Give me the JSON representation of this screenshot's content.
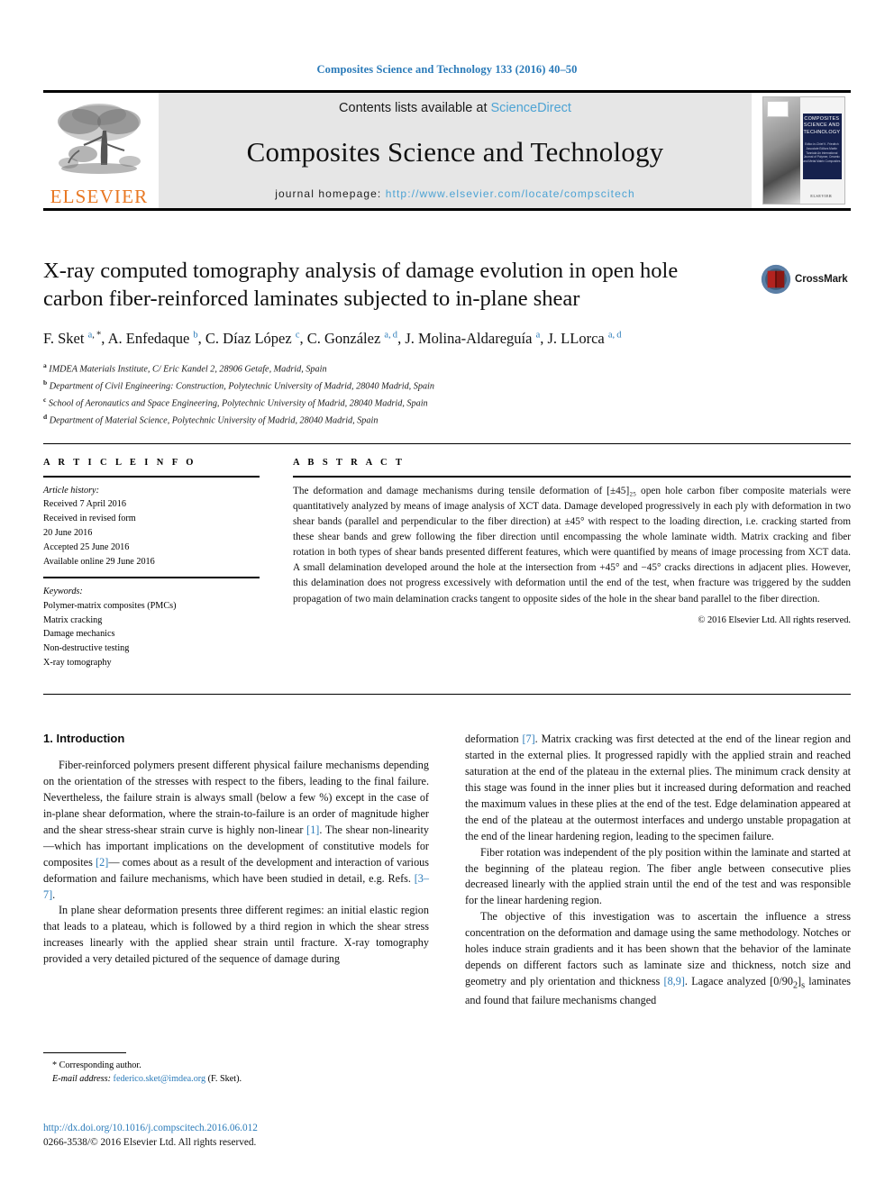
{
  "running_head": "Composites Science and Technology 133 (2016) 40–50",
  "masthead": {
    "contents_prefix": "Contents lists available at ",
    "sciencedirect": "ScienceDirect",
    "journal_name": "Composites Science and Technology",
    "homepage_label": "journal homepage: ",
    "homepage_url": "http://www.elsevier.com/locate/compscitech",
    "publisher": "ELSEVIER",
    "cover": {
      "title": "COMPOSITES SCIENCE AND TECHNOLOGY",
      "subtitle": "Editor-in-Chief\nK. Friedrich\n\nAssociate Editors\nMartin Tanniala\n\nAn International Journal\nof Polymer, Ceramic and Metal\nMatrix Composites",
      "publisher": "ELSEVIER"
    }
  },
  "article": {
    "title": "X-ray computed tomography analysis of damage evolution in open hole carbon fiber-reinforced laminates subjected to in-plane shear",
    "crossmark_label": "CrossMark",
    "authors_html": "F. Sket <sup>a, *</sup>, A. Enfedaque <sup>b</sup>, C. Díaz López <sup>c</sup>, C. González <sup>a, d</sup>, J. Molina-Aldareguía <sup>a</sup>, J. LLorca <sup>a, d</sup>",
    "affiliations": [
      {
        "mark": "a",
        "text": "IMDEA Materials Institute, C/ Eric Kandel 2, 28906 Getafe, Madrid, Spain"
      },
      {
        "mark": "b",
        "text": "Department of Civil Engineering: Construction, Polytechnic University of Madrid, 28040 Madrid, Spain"
      },
      {
        "mark": "c",
        "text": "School of Aeronautics and Space Engineering, Polytechnic University of Madrid, 28040 Madrid, Spain"
      },
      {
        "mark": "d",
        "text": "Department of Material Science, Polytechnic University of Madrid, 28040 Madrid, Spain"
      }
    ]
  },
  "article_info": {
    "heading": "A R T I C L E   I N F O",
    "history_label": "Article history:",
    "history": [
      "Received 7 April 2016",
      "Received in revised form",
      "20 June 2016",
      "Accepted 25 June 2016",
      "Available online 29 June 2016"
    ],
    "keywords_label": "Keywords:",
    "keywords": [
      "Polymer-matrix composites (PMCs)",
      "Matrix cracking",
      "Damage mechanics",
      "Non-destructive testing",
      "X-ray tomography"
    ]
  },
  "abstract": {
    "heading": "A B S T R A C T",
    "text": "The deformation and damage mechanisms during tensile deformation of [±45]₂₅ open hole carbon fiber composite materials were quantitatively analyzed by means of image analysis of XCT data. Damage developed progressively in each ply with deformation in two shear bands (parallel and perpendicular to the fiber direction) at ±45° with respect to the loading direction, i.e. cracking started from these shear bands and grew following the fiber direction until encompassing the whole laminate width. Matrix cracking and fiber rotation in both types of shear bands presented different features, which were quantified by means of image processing from XCT data. A small delamination developed around the hole at the intersection from +45° and −45° cracks directions in adjacent plies. However, this delamination does not progress excessively with deformation until the end of the test, when fracture was triggered by the sudden propagation of two main delamination cracks tangent to opposite sides of the hole in the shear band parallel to the fiber direction.",
    "copyright": "© 2016 Elsevier Ltd. All rights reserved."
  },
  "body": {
    "section_title": "1.  Introduction",
    "left_paragraphs": [
      "Fiber-reinforced polymers present different physical failure mechanisms depending on the orientation of the stresses with respect to the fibers, leading to the final failure. Nevertheless, the failure strain is always small (below a few %) except in the case of in-plane shear deformation, where the strain-to-failure is an order of magnitude higher and the shear stress-shear strain curve is highly non-linear [1]. The shear non-linearity —which has important implications on the development of constitutive models for composites [2]— comes about as a result of the development and interaction of various deformation and failure mechanisms, which have been studied in detail, e.g. Refs. [3–7].",
      "In plane shear deformation presents three different regimes: an initial elastic region that leads to a plateau, which is followed by a third region in which the shear stress increases linearly with the applied shear strain until fracture. X-ray tomography provided a very detailed pictured of the sequence of damage during"
    ],
    "right_paragraphs": [
      "deformation [7]. Matrix cracking was first detected at the end of the linear region and started in the external plies. It progressed rapidly with the applied strain and reached saturation at the end of the plateau in the external plies. The minimum crack density at this stage was found in the inner plies but it increased during deformation and reached the maximum values in these plies at the end of the test. Edge delamination appeared at the end of the plateau at the outermost interfaces and undergo unstable propagation at the end of the linear hardening region, leading to the specimen failure.",
      "Fiber rotation was independent of the ply position within the laminate and started at the beginning of the plateau region. The fiber angle between consecutive plies decreased linearly with the applied strain until the end of the test and was responsible for the linear hardening region.",
      "The objective of this investigation was to ascertain the influence a stress concentration on the deformation and damage using the same methodology. Notches or holes induce strain gradients and it has been shown that the behavior of the laminate depends on different factors such as laminate size and thickness, notch size and geometry and ply orientation and thickness [8,9]. Lagace analyzed [0/90₂]ₛ laminates and found that failure mechanisms changed"
    ]
  },
  "footnote": {
    "corresponding": "* Corresponding author.",
    "email_label": "E-mail address: ",
    "email": "federico.sket@imdea.org",
    "email_suffix": " (F. Sket)."
  },
  "footer": {
    "doi": "http://dx.doi.org/10.1016/j.compscitech.2016.06.012",
    "issn": "0266-3538/© 2016 Elsevier Ltd. All rights reserved."
  },
  "colors": {
    "link_blue": "#2b7bb9",
    "sciencedirect_blue": "#4da3d4",
    "elsevier_orange": "#e87722",
    "cover_navy": "#16214d",
    "crossmark_red": "#b3231f"
  }
}
